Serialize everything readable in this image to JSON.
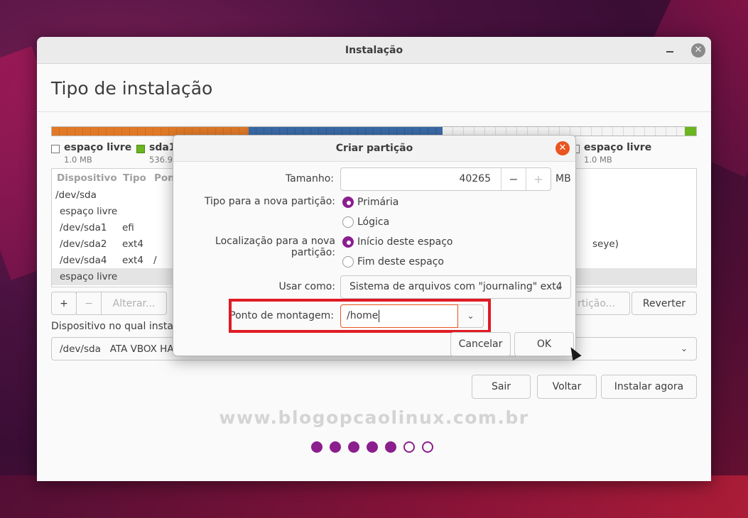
{
  "window": {
    "title": "Instalação",
    "close_glyph": "✕"
  },
  "page": {
    "title": "Tipo de instalação"
  },
  "partition_bar": {
    "colors": {
      "orange": "#e07a28",
      "blue": "#3b6ba8",
      "free": "#f4f4f4",
      "green": "#6ab520"
    }
  },
  "legend": [
    {
      "label": "espaço livre",
      "size": "1.0 MB",
      "color": "#ffffff"
    },
    {
      "label": "sda1",
      "size": "536.9",
      "color": "#6ab520"
    },
    {
      "label": "espaço livre",
      "size": "1.0 MB",
      "color": "#ffffff"
    }
  ],
  "table": {
    "headers": [
      "Dispositivo",
      "Tipo",
      "Pon"
    ],
    "rows": [
      {
        "device": "/dev/sda",
        "type": "",
        "mount": ""
      },
      {
        "device": "espaço livre",
        "type": "",
        "mount": ""
      },
      {
        "device": "/dev/sda1",
        "type": "efi",
        "mount": ""
      },
      {
        "device": "/dev/sda2",
        "type": "ext4",
        "mount": ""
      },
      {
        "device": "/dev/sda4",
        "type": "ext4",
        "mount": "/"
      },
      {
        "device": "espaço livre",
        "type": "",
        "mount": ""
      }
    ],
    "overflow_text": "seye)"
  },
  "table_buttons": {
    "add": "+",
    "remove": "−",
    "change": "Alterar...",
    "new_table": "rtição...",
    "revert": "Reverter"
  },
  "boot_device": {
    "label": "Dispositivo no qual instala",
    "value": "/dev/sda   ATA VBOX HA"
  },
  "nav": {
    "quit": "Sair",
    "back": "Voltar",
    "install": "Instalar agora"
  },
  "watermark": "www.blogopcaolinux.com.br",
  "progress": {
    "total": 7,
    "done": 5
  },
  "dialog": {
    "title": "Criar partição",
    "size_label": "Tamanho:",
    "size_value": "40265",
    "size_unit": "MB",
    "type_label": "Tipo para a nova partição:",
    "type_options": [
      "Primária",
      "Lógica"
    ],
    "type_selected": "Primária",
    "location_label": "Localização para a nova partição:",
    "location_options": [
      "Início deste espaço",
      "Fim deste espaço"
    ],
    "location_selected": "Início deste espaço",
    "use_as_label": "Usar como:",
    "use_as_value": "Sistema de arquivos com \"journaling\" ext4",
    "mount_label": "Ponto de montagem:",
    "mount_value": "/home",
    "cancel": "Cancelar",
    "ok": "OK"
  }
}
